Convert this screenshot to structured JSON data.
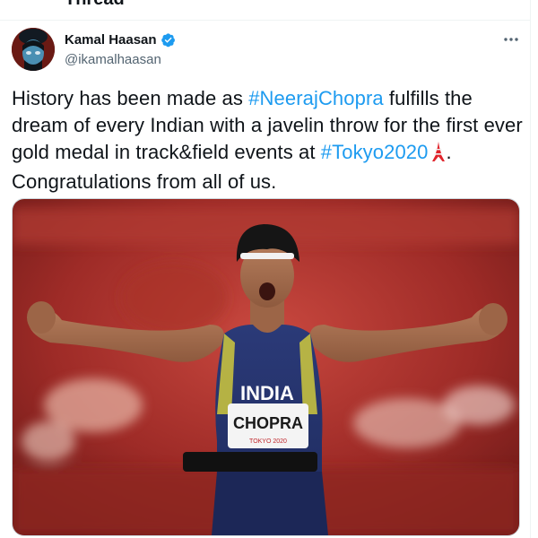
{
  "header": {
    "title": "Thread"
  },
  "author": {
    "name": "Kamal Haasan",
    "handle": "@ikamalhaasan",
    "verified": true
  },
  "tweet": {
    "text_part1": "History has been made as ",
    "hashtag1": "#NeerajChopra",
    "text_part2": " fulfills the dream of every Indian with a javelin throw for the first ever gold medal in track&field events at ",
    "hashtag2": "#Tokyo2020",
    "emoji_icon": "tokyo-tower-icon",
    "text_part3": ". Congratulations from all of us."
  },
  "media": {
    "jersey_top": "INDIA",
    "bib_name": "CHOPRA",
    "bib_small": "TOKYO 2020"
  },
  "colors": {
    "accent": "#1d9bf0",
    "text": "#0f1419",
    "secondary": "#536471"
  }
}
